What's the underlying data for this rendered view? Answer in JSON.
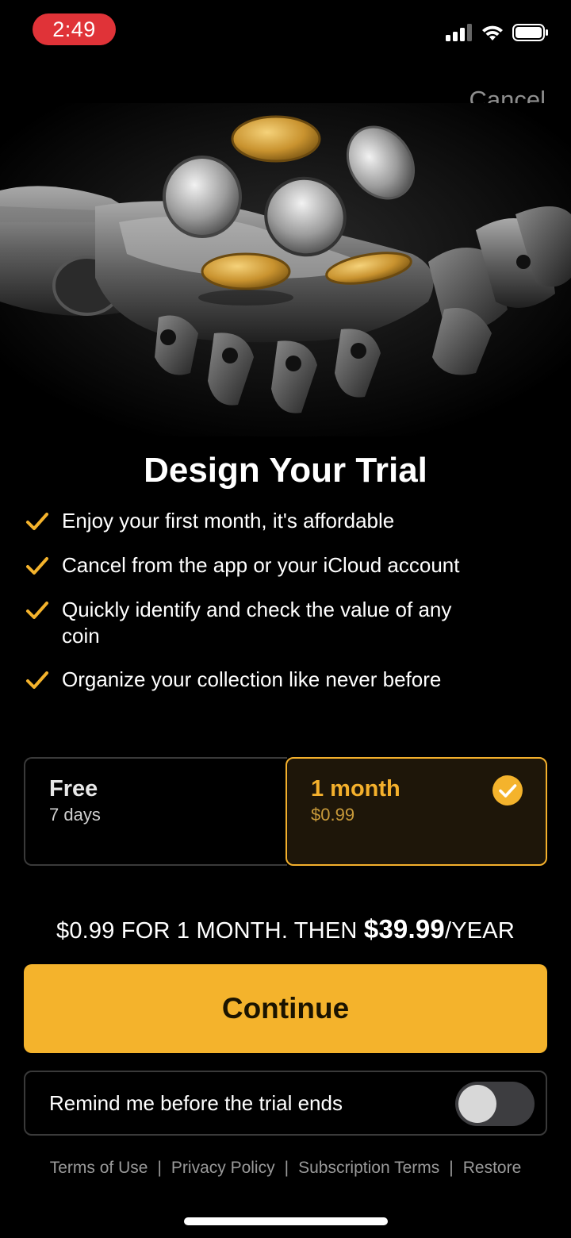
{
  "status_bar": {
    "time": "2:49",
    "icons": [
      "signal-icon",
      "wifi-icon",
      "battery-icon"
    ]
  },
  "cancel_label": "Cancel",
  "title": "Design Your Trial",
  "features": [
    {
      "icon": "checkmark-icon",
      "text": "Enjoy your first month, it's affordable"
    },
    {
      "icon": "checkmark-icon",
      "text": "Cancel from the app or your iCloud account"
    },
    {
      "icon": "checkmark-icon",
      "text": "Quickly identify and check the value of any coin"
    },
    {
      "icon": "checkmark-icon",
      "text": "Organize your collection like never before"
    }
  ],
  "plans": [
    {
      "name": "Free",
      "detail": "7 days",
      "selected": false
    },
    {
      "name": "1 month",
      "detail": "$0.99",
      "selected": true
    }
  ],
  "price_line": {
    "prefix": "$0.99 FOR 1 MONTH. THEN ",
    "amount": "$39.99",
    "suffix": "/YEAR"
  },
  "continue_label": "Continue",
  "reminder": {
    "label": "Remind me before the trial ends",
    "enabled": false
  },
  "footer_links": [
    "Terms of Use",
    "Privacy Policy",
    "Subscription Terms",
    "Restore"
  ],
  "footer_separator": "|",
  "colors": {
    "accent": "#f4b32c",
    "background": "#000000",
    "time_pill": "#e03338"
  }
}
